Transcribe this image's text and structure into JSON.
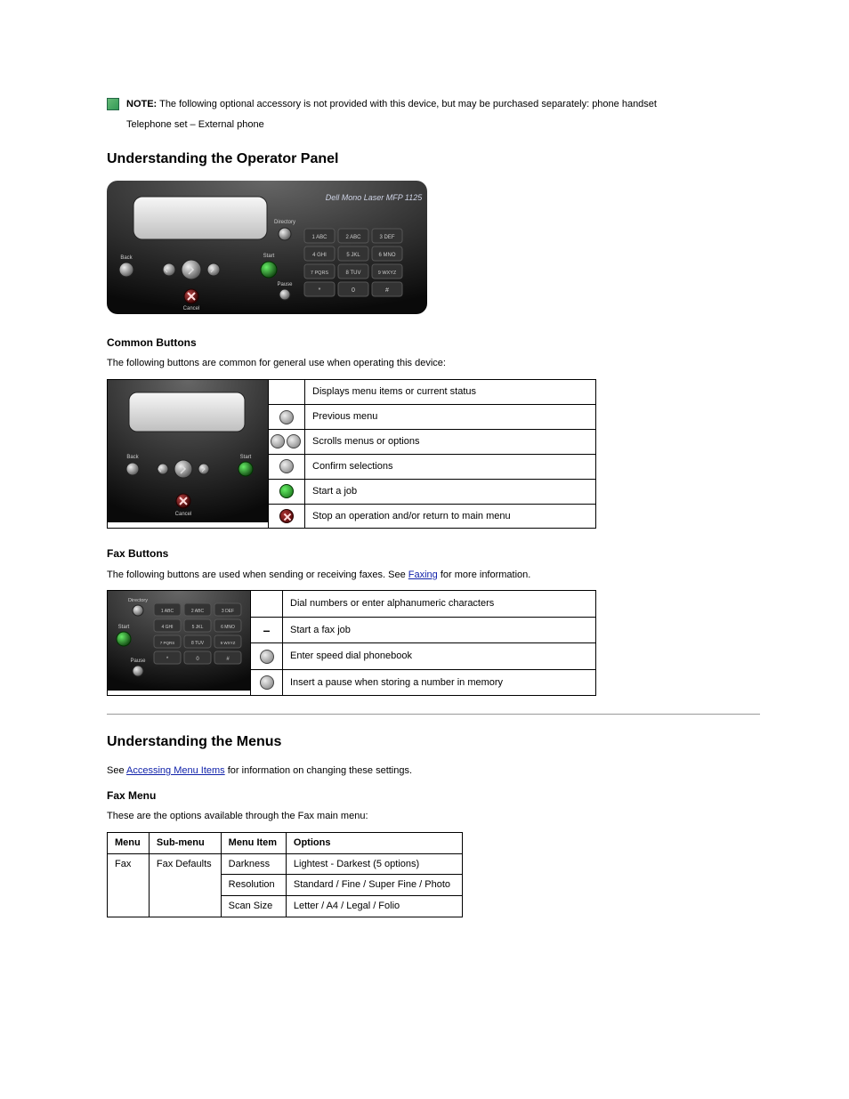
{
  "note": {
    "prefix": "NOTE:",
    "text": "The following optional accessory is not provided with this device, but may be purchased separately: phone handset",
    "telephone_set": "Telephone set – External phone"
  },
  "section2": {
    "title": "Understanding the Operator Panel",
    "panel_label": "Dell Mono Laser MFP 1125",
    "labels": {
      "back": "Back",
      "cancel": "Cancel",
      "directory": "Directory",
      "start": "Start",
      "pause": "Pause"
    },
    "keys": [
      "1 ABC",
      "2 ABC",
      "3 DEF",
      "4 GHI",
      "5 JKL",
      "6 MNO",
      "7 PQRS",
      "8 TUV",
      "9 WXYZ",
      "*",
      "0",
      "#"
    ]
  },
  "common": {
    "title": "Common Buttons",
    "intro": "The following buttons are common for general use when operating this device:",
    "rows": [
      {
        "label": "LCD",
        "desc": "Displays menu items or current status"
      },
      {
        "label": "back-btn",
        "desc": "Previous menu"
      },
      {
        "label": "scroll-btns",
        "desc": "Scrolls menus or options"
      },
      {
        "label": "ok-btn",
        "desc": "Confirm selections"
      },
      {
        "label": "start-btn",
        "desc": "Start a job"
      },
      {
        "label": "cancel-btn",
        "desc": "Stop an operation and/or return to main menu"
      }
    ]
  },
  "fax": {
    "title": "Fax Buttons",
    "intro_a": "The following buttons are used when sending or receiving faxes. See ",
    "link": "Faxing",
    "intro_b": " for more information.",
    "rows": [
      {
        "label": "keypad",
        "desc": "Dial numbers or enter alphanumeric characters"
      },
      {
        "label": "start-btn",
        "desc": "Start a fax job"
      },
      {
        "label": "directory-btn",
        "desc": "Enter speed dial phonebook"
      },
      {
        "label": "pause-btn",
        "desc": "Insert a pause when storing a number in memory"
      }
    ]
  },
  "menus": {
    "title": "Understanding the Menus",
    "intro_a": "See ",
    "link": "Accessing Menu Items",
    "intro_b": " for information on changing these settings.",
    "fax_title": "Fax Menu",
    "fax_intro": "These are the options available through the Fax main menu:",
    "headers": {
      "menu": "Menu",
      "submenu": "Sub-menu",
      "items": "Menu Item",
      "options": "Options"
    },
    "rows": [
      {
        "menu": "Fax",
        "submenu": "Fax Defaults",
        "item": "Darkness",
        "options": "Lightest - Darkest (5 options)"
      },
      {
        "menu": "",
        "submenu": "",
        "item": "Resolution",
        "options": "Standard / Fine / Super Fine / Photo"
      },
      {
        "menu": "",
        "submenu": "",
        "item": "Scan Size",
        "options": "Letter / A4 / Legal / Folio"
      }
    ]
  }
}
